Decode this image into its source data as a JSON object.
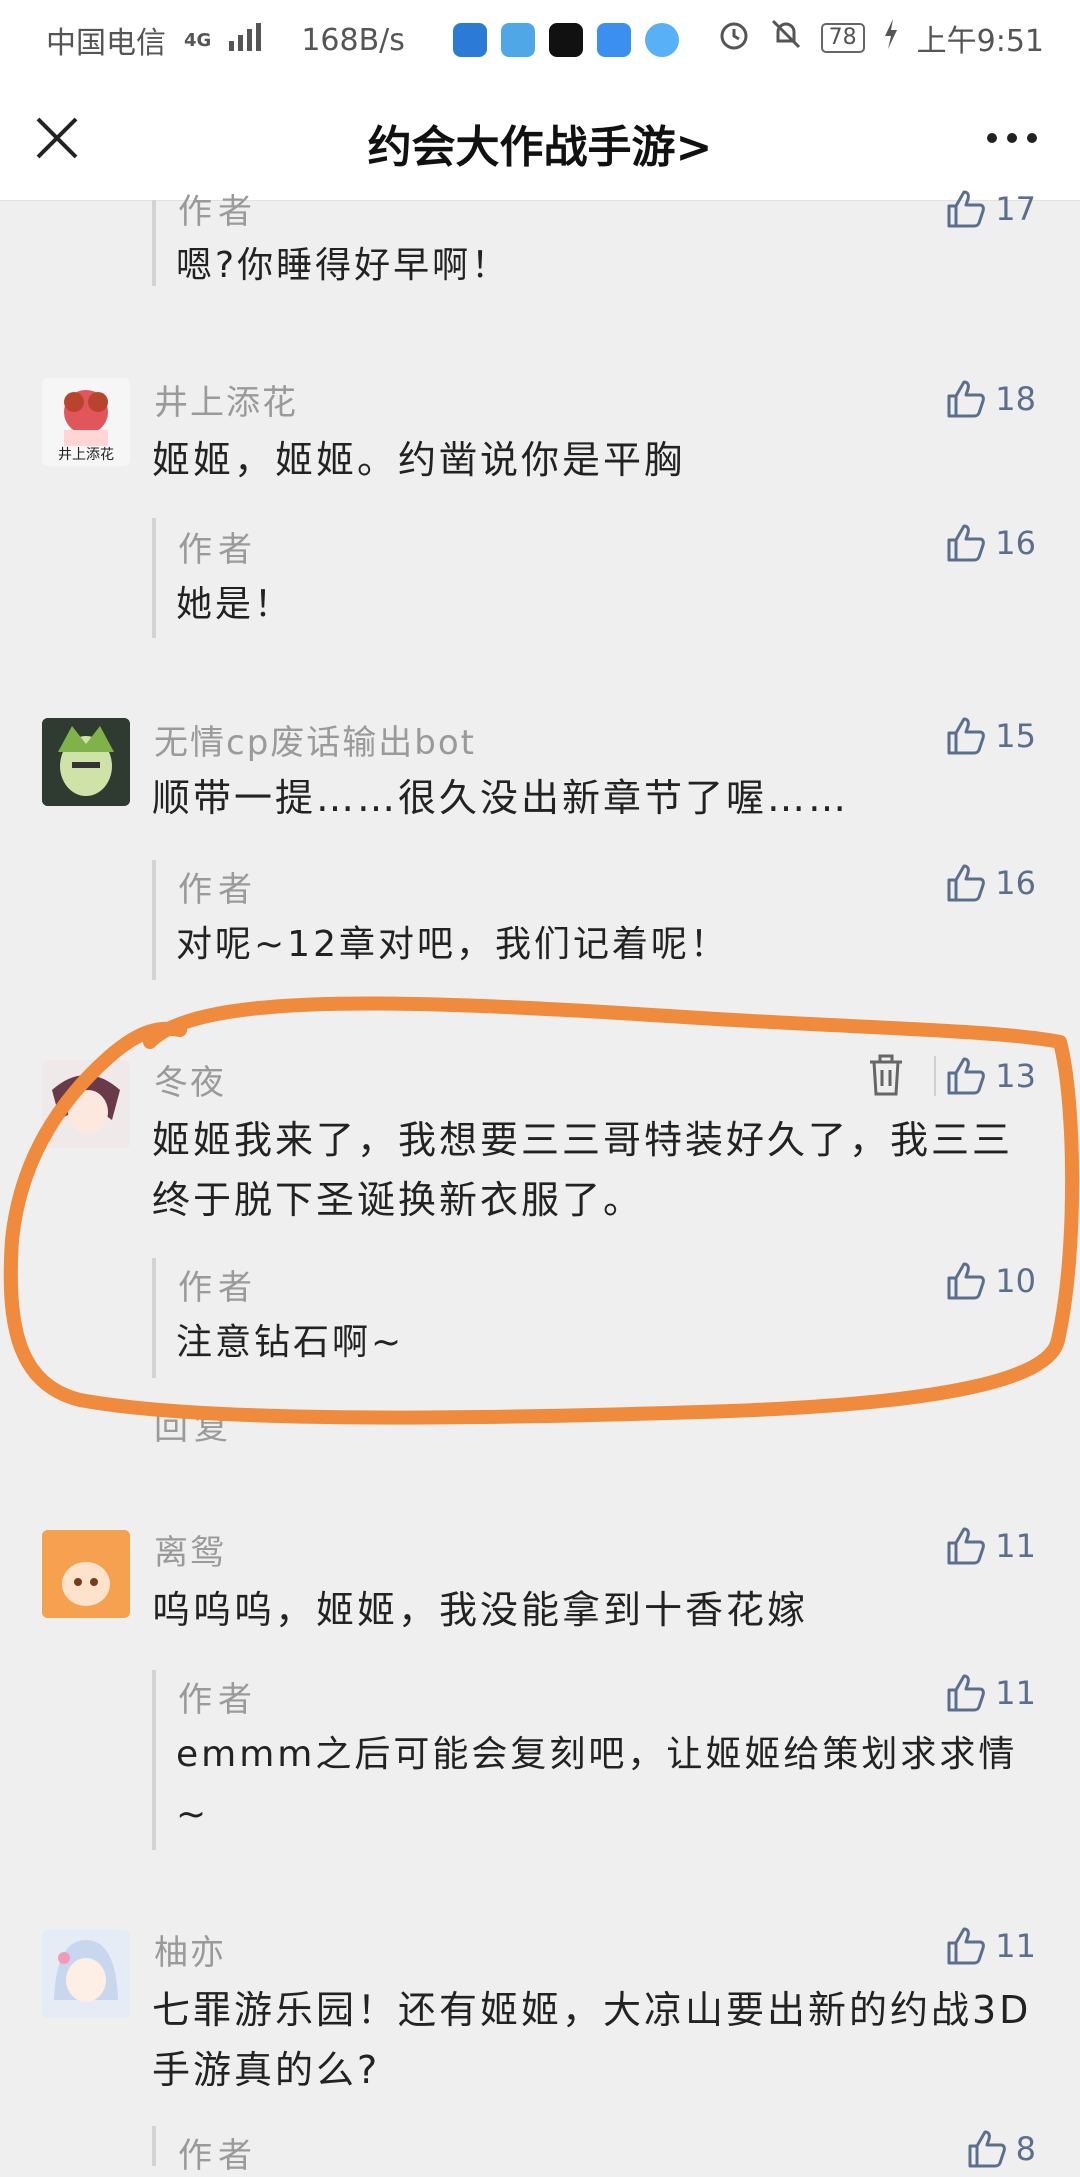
{
  "status_bar": {
    "carrier": "中国电信",
    "network": "4G",
    "speed": "168B/s",
    "battery": "78",
    "time": "上午9:51"
  },
  "header": {
    "title": "约会大作战手游>"
  },
  "comments": [
    {
      "reply": {
        "label": "作者",
        "text": "嗯?你睡得好早啊！",
        "likes": "17"
      }
    },
    {
      "name": "井上添花",
      "avatar_text": "井上添花",
      "text": "姬姬，姬姬。约凿说你是平胸",
      "likes": "18",
      "reply": {
        "label": "作者",
        "text": "她是！",
        "likes": "16"
      }
    },
    {
      "name": "无情cp废话输出bot",
      "text": "顺带一提……很久没出新章节了喔……",
      "likes": "15",
      "reply": {
        "label": "作者",
        "text": "对呢~12章对吧，我们记着呢！",
        "likes": "16"
      }
    },
    {
      "name": "冬夜",
      "text": "姬姬我来了，我想要三三哥特装好久了，我三三终于脱下圣诞换新衣服了。",
      "likes": "13",
      "reply": {
        "label": "作者",
        "text": "注意钻石啊~",
        "likes": "10"
      },
      "reply_link": "回复"
    },
    {
      "name": "离鸳",
      "text": "呜呜呜，姬姬，我没能拿到十香花嫁",
      "likes": "11",
      "reply": {
        "label": "作者",
        "text": "emmm之后可能会复刻吧，让姬姬给策划求求情~",
        "likes": "11"
      }
    },
    {
      "name": "柚亦",
      "text": "七罪游乐园！还有姬姬，大凉山要出新的约战3D手游真的么?",
      "likes": "11",
      "reply": {
        "label": "作者",
        "likes": "8"
      }
    }
  ],
  "colors": {
    "accent_like": "#5b6f8c",
    "annotation": "#f08a3c",
    "background": "#efefef"
  },
  "icons": [
    "close-icon",
    "more-icon",
    "thumb-up-icon",
    "trash-icon"
  ]
}
